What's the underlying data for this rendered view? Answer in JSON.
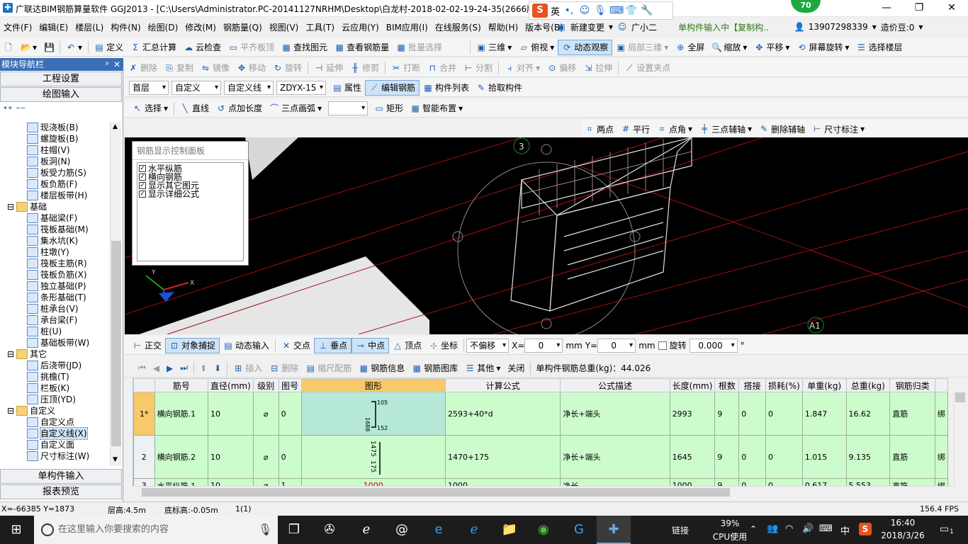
{
  "window": {
    "title": "广联达BIM钢筋算量软件 GGJ2013 - [C:\\Users\\Administrator.PC-20141127NRHM\\Desktop\\白龙村-2018-02-02-19-24-35(2666版",
    "badge": "70"
  },
  "ime": {
    "lang": "英"
  },
  "menu": [
    "文件(F)",
    "编辑(E)",
    "楼层(L)",
    "构件(N)",
    "绘图(D)",
    "修改(M)",
    "钢筋量(Q)",
    "视图(V)",
    "工具(T)",
    "云应用(Y)",
    "BIM应用(I)",
    "在线服务(S)",
    "帮助(H)",
    "版本号(B)"
  ],
  "menu_right": {
    "new_change": "新建变更",
    "assistant": "广小二",
    "notice": "单构件输入中【复制构..",
    "phone": "13907298339",
    "cost": "造价豆:0"
  },
  "toolbar1": {
    "define": "定义",
    "sum": "汇总计算",
    "cloud_check": "云检查",
    "flat_top": "平齐板顶",
    "find": "查找图元",
    "view_rebar": "查看钢筋量",
    "batch_select": "批量选择",
    "three_d": "三维",
    "top_view": "俯视",
    "dynamic": "动态观察",
    "local_3d": "局部三维",
    "fullscreen": "全屏",
    "zoom": "缩放",
    "pan": "平移",
    "rotate_screen": "屏幕旋转",
    "select_floor": "选择楼层"
  },
  "toolbar2": {
    "delete": "删除",
    "copy": "复制",
    "mirror": "镜像",
    "move": "移动",
    "rotate": "旋转",
    "extend": "延伸",
    "trim": "修剪",
    "break": "打断",
    "merge": "合并",
    "split": "分割",
    "align": "对齐",
    "offset": "偏移",
    "stretch": "拉伸",
    "set_grip": "设置夹点"
  },
  "toolbar3": {
    "floor": "首层",
    "custom": "自定义",
    "custom_line": "自定义线",
    "code": "ZDYX-15",
    "props": "属性",
    "edit_rebar": "编辑钢筋",
    "comp_list": "构件列表",
    "pick": "拾取构件"
  },
  "toolbar4": {
    "select": "选择",
    "line": "直线",
    "add_length": "点加长度",
    "arc": "三点画弧",
    "rect": "矩形",
    "smart": "智能布置"
  },
  "toolbar5": {
    "two_point": "两点",
    "parallel": "平行",
    "point_angle": "点角",
    "three_axis": "三点辅轴",
    "del_axis": "删除辅轴",
    "dim": "尺寸标注"
  },
  "nav": {
    "header": "模块导航栏",
    "pin": "✕",
    "project_settings": "工程设置",
    "drawing_input": "绘图输入",
    "single_input": "单构件输入",
    "report": "报表预览",
    "tree": [
      {
        "label": "现浇板(B)",
        "lvl": 2
      },
      {
        "label": "螺旋板(B)",
        "lvl": 2
      },
      {
        "label": "柱帽(V)",
        "lvl": 2
      },
      {
        "label": "板洞(N)",
        "lvl": 2
      },
      {
        "label": "板受力筋(S)",
        "lvl": 2
      },
      {
        "label": "板负筋(F)",
        "lvl": 2
      },
      {
        "label": "楼层板带(H)",
        "lvl": 2
      },
      {
        "label": "基础",
        "lvl": 1
      },
      {
        "label": "基础梁(F)",
        "lvl": 2
      },
      {
        "label": "筏板基础(M)",
        "lvl": 2
      },
      {
        "label": "集水坑(K)",
        "lvl": 2
      },
      {
        "label": "柱墩(Y)",
        "lvl": 2
      },
      {
        "label": "筏板主筋(R)",
        "lvl": 2
      },
      {
        "label": "筏板负筋(X)",
        "lvl": 2
      },
      {
        "label": "独立基础(P)",
        "lvl": 2
      },
      {
        "label": "条形基础(T)",
        "lvl": 2
      },
      {
        "label": "桩承台(V)",
        "lvl": 2
      },
      {
        "label": "承台梁(F)",
        "lvl": 2
      },
      {
        "label": "桩(U)",
        "lvl": 2
      },
      {
        "label": "基础板带(W)",
        "lvl": 2
      },
      {
        "label": "其它",
        "lvl": 1
      },
      {
        "label": "后浇带(JD)",
        "lvl": 2
      },
      {
        "label": "挑檐(T)",
        "lvl": 2
      },
      {
        "label": "栏板(K)",
        "lvl": 2
      },
      {
        "label": "压顶(YD)",
        "lvl": 2
      },
      {
        "label": "自定义",
        "lvl": 1
      },
      {
        "label": "自定义点",
        "lvl": 2
      },
      {
        "label": "自定义线(X)",
        "lvl": 2,
        "selected": true
      },
      {
        "label": "自定义面",
        "lvl": 2
      },
      {
        "label": "尺寸标注(W)",
        "lvl": 2
      }
    ]
  },
  "rebar_panel": {
    "title": "钢筋显示控制面板",
    "items": [
      "水平纵筋",
      "横向钢筋",
      "显示其它图元",
      "显示详细公式"
    ]
  },
  "axis_labels": {
    "c3": "3",
    "ca1": "A1",
    "x": "X",
    "y": "Y"
  },
  "snapbar": {
    "ortho": "正交",
    "snap": "对象捕捉",
    "dyn_input": "动态输入",
    "intersect": "交点",
    "perp": "垂点",
    "mid": "中点",
    "vertex": "顶点",
    "coord": "坐标",
    "no_offset": "不偏移",
    "x_label": "X=",
    "x_val": "0",
    "mm1": "mm",
    "y_label": "Y=",
    "y_val": "0",
    "mm2": "mm",
    "rotate": "旋转",
    "rot_val": "0.000",
    "deg": "°"
  },
  "gridbar": {
    "insert": "插入",
    "delete": "删除",
    "scale": "缩尺配筋",
    "info": "钢筋信息",
    "lib": "钢筋图库",
    "other": "其他",
    "close": "关闭",
    "total": "单构件钢筋总重(kg)：44.026"
  },
  "grid": {
    "columns": [
      "",
      "筋号",
      "直径(mm)",
      "级别",
      "图号",
      "图形",
      "计算公式",
      "公式描述",
      "长度(mm)",
      "根数",
      "搭接",
      "损耗(%)",
      "单重(kg)",
      "总重(kg)",
      "钢筋归类",
      ""
    ],
    "rows": [
      {
        "idx": "1*",
        "name": "横向钢筋.1",
        "dia": "10",
        "grade": "⌀",
        "fig": "0",
        "shape": [
          "105",
          "1688",
          "152"
        ],
        "formula": "2593+40*d",
        "desc": "净长+端头",
        "len": "2993",
        "count": "9",
        "lap": "0",
        "loss": "0",
        "unit": "1.847",
        "total": "16.62",
        "cat": "直筋",
        "tail": "绑"
      },
      {
        "idx": "2",
        "name": "横向钢筋.2",
        "dia": "10",
        "grade": "⌀",
        "fig": "0",
        "shape": [
          "1475",
          "175"
        ],
        "formula": "1470+175",
        "desc": "净长+端头",
        "len": "1645",
        "count": "9",
        "lap": "0",
        "loss": "0",
        "unit": "1.015",
        "total": "9.135",
        "cat": "直筋",
        "tail": "绑"
      },
      {
        "idx": "3",
        "name": "水平纵筋.1",
        "dia": "10",
        "grade": "⌀",
        "fig": "1",
        "shape": [
          "1000"
        ],
        "formula": "1000",
        "desc": "净长",
        "len": "1000",
        "count": "9",
        "lap": "0",
        "loss": "0",
        "unit": "0.617",
        "total": "5.553",
        "cat": "直筋",
        "tail": "绑"
      }
    ]
  },
  "status": {
    "coords": "X=-66385 Y=1873",
    "floor_h": "层高:4.5m",
    "base_h": "底标高:-0.05m",
    "count": "1(1)",
    "fps": "156.4 FPS"
  },
  "taskbar": {
    "search": "在这里输入你要搜索的内容",
    "link": "链接",
    "cpu_pct": "39%",
    "cpu": "CPU使用",
    "ime": "中",
    "time": "16:40",
    "date": "2018/3/26",
    "notif": "1"
  }
}
